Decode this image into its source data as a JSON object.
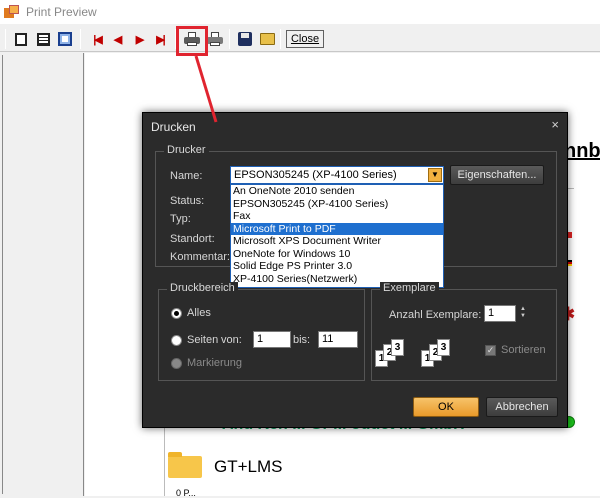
{
  "window": {
    "title": "Print Preview"
  },
  "toolbar": {
    "close_label": "Close",
    "icons": [
      "single-page-icon",
      "two-page-icon",
      "page-width-icon",
      "first-page-icon",
      "previous-page-icon",
      "next-page-icon",
      "last-page-icon",
      "print-icon",
      "print-setup-icon",
      "save-icon",
      "open-icon"
    ]
  },
  "document": {
    "heading_fragment": "nnb",
    "teal_line": "And Ken ... Gr ... oduct ... GmbH",
    "folder_label": "GT+LMS",
    "small_text": "0 P..."
  },
  "dialog": {
    "title": "Drucken",
    "close_glyph": "×",
    "printer_group": {
      "title": "Drucker",
      "name_label": "Name:",
      "status_label": "Status:",
      "type_label": "Typ:",
      "location_label": "Standort:",
      "comment_label": "Kommentar:",
      "selected_printer": "EPSON305245 (XP-4100 Series)",
      "properties_button": "Eigenschaften...",
      "printer_options": [
        "An OneNote 2010 senden",
        "EPSON305245 (XP-4100 Series)",
        "Fax",
        "Microsoft Print to PDF",
        "Microsoft XPS Document Writer",
        "OneNote for Windows 10",
        "Solid Edge PS Printer 3.0",
        "XP-4100 Series(Netzwerk)"
      ],
      "highlighted_option": "Microsoft Print to PDF"
    },
    "range_group": {
      "title": "Druckbereich",
      "all_label": "Alles",
      "pages_label": "Seiten",
      "from_label": "von:",
      "to_label": "bis:",
      "from_value": "1",
      "to_value": "11",
      "selection_label": "Markierung"
    },
    "copies_group": {
      "title": "Exemplare",
      "count_label": "Anzahl Exemplare:",
      "count_value": "1",
      "collate_label": "Sortieren"
    },
    "ok_button": "OK",
    "cancel_button": "Abbrechen"
  },
  "colors": {
    "annotation_red": "#e0242f",
    "dialog_bg": "#2b2b2b",
    "ok_orange": "#f2b140",
    "selection_blue": "#1e6fcf"
  }
}
